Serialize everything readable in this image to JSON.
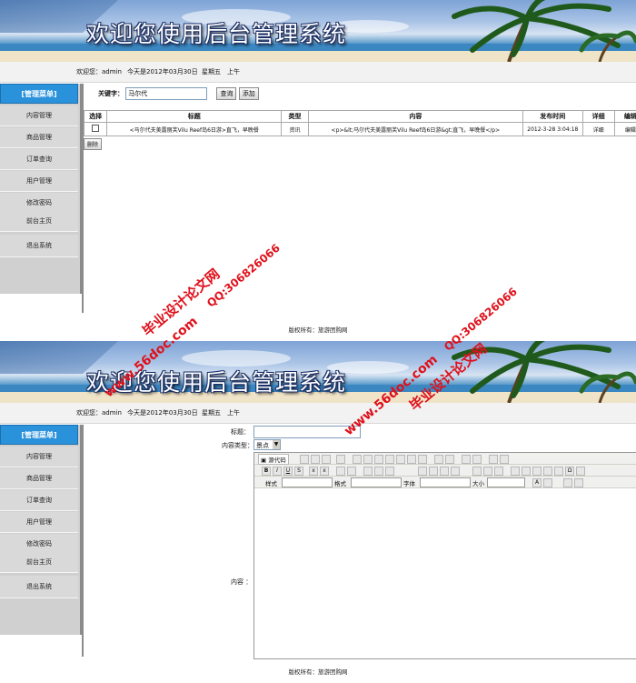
{
  "banner": {
    "title": "欢迎您使用后台管理系统"
  },
  "infobar": {
    "welcome": "欢迎您：admin",
    "date": "今天是2012年03月30日",
    "weekday": "星期五",
    "ampm": "上午"
  },
  "sidebar": {
    "head": "[管理菜单]",
    "items": [
      {
        "label": "内容管理"
      },
      {
        "label": "商品管理"
      },
      {
        "label": "订单查询"
      },
      {
        "label": "用户管理"
      },
      {
        "label": "修改密码"
      },
      {
        "label": "前台主页"
      },
      {
        "label": "退出系统"
      }
    ]
  },
  "search": {
    "label": "关键字：",
    "value": "马尔代",
    "search_button": "查询",
    "add_button": "添加"
  },
  "table": {
    "headers": [
      "选择",
      "标题",
      "类型",
      "内容",
      "发布时间",
      "详细",
      "编辑"
    ],
    "row": {
      "title": "<马尔代夫美露丽芙Vilu Reef岛6日游>直飞，早晚餐",
      "type": "资讯",
      "content": "<p>&lt;马尔代夫美露丽芙Vilu Reef岛6日游&gt;直飞，早晚餐</p>",
      "time": "2012-3-28 3:04:18",
      "detail": "详细",
      "edit": "编辑"
    },
    "delete_button": "删除"
  },
  "footer": {
    "text": "版权所有：旅游团购网"
  },
  "form": {
    "title_label": "标题：",
    "type_label": "内容类型：",
    "type_value": "景点",
    "content_label": "内容 ："
  },
  "editor": {
    "source_button": "源代码",
    "style_label": "样式",
    "format_label": "格式",
    "font_label": "字体",
    "size_label": "大小"
  },
  "watermark": {
    "site1": "毕业设计论文网",
    "qq": "QQ:306826066",
    "url": "www.56doc.com"
  },
  "colors": {
    "accent": "#2a91db",
    "sidebar_bg": "#d0d0d0",
    "watermark": "#e0101a"
  }
}
